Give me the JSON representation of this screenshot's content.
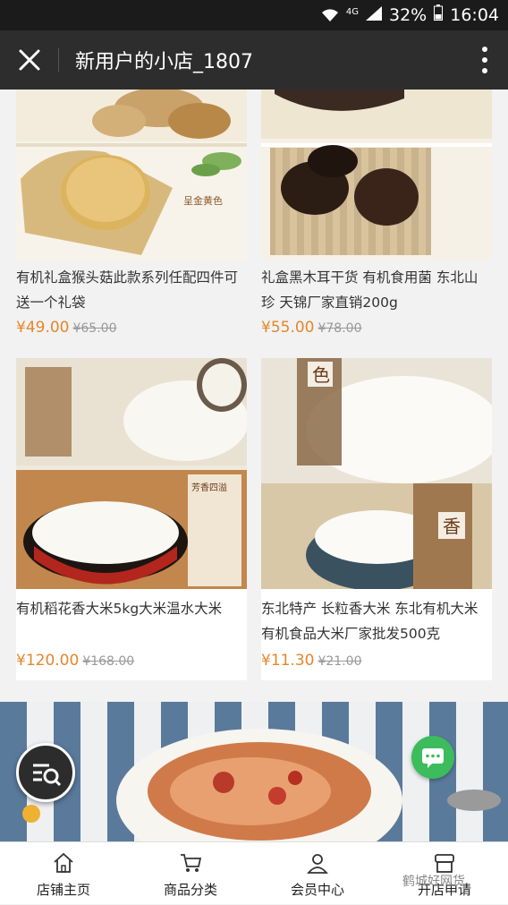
{
  "status_bar": {
    "network": "4G",
    "battery": "32%",
    "time": "16:04"
  },
  "app_bar": {
    "title": "新用户的小店_1807"
  },
  "products": [
    {
      "name": "有机礼盒猴头菇此款系列任配四件可送一个礼袋",
      "price": "¥49.00",
      "original_price": "¥65.00",
      "image_caption": "呈金黄色"
    },
    {
      "name": "礼盒黑木耳干货 有机食用菌 东北山珍 天锦厂家直销200g",
      "price": "¥55.00",
      "original_price": "¥78.00"
    },
    {
      "name": "有机稻花香大米5kg大米温水大米",
      "price": "¥120.00",
      "original_price": "¥168.00",
      "image_caption": "芳香四溢"
    },
    {
      "name": "东北特产 长粒香大米 东北有机大米 有机食品大米厂家批发500克",
      "price": "¥11.30",
      "original_price": "¥21.00",
      "image_caption_1": "色",
      "image_caption_2": "香"
    }
  ],
  "tab_bar": {
    "items": [
      {
        "label": "店铺主页",
        "icon": "home-icon"
      },
      {
        "label": "商品分类",
        "icon": "cart-icon"
      },
      {
        "label": "会员中心",
        "icon": "user-icon"
      },
      {
        "label": "开店申请",
        "icon": "shop-icon"
      }
    ]
  },
  "watermark": "鹤城好网货",
  "colors": {
    "price": "#e5862c",
    "app_bar": "#2d2d2d",
    "chat_fab": "#3cbc5c"
  }
}
